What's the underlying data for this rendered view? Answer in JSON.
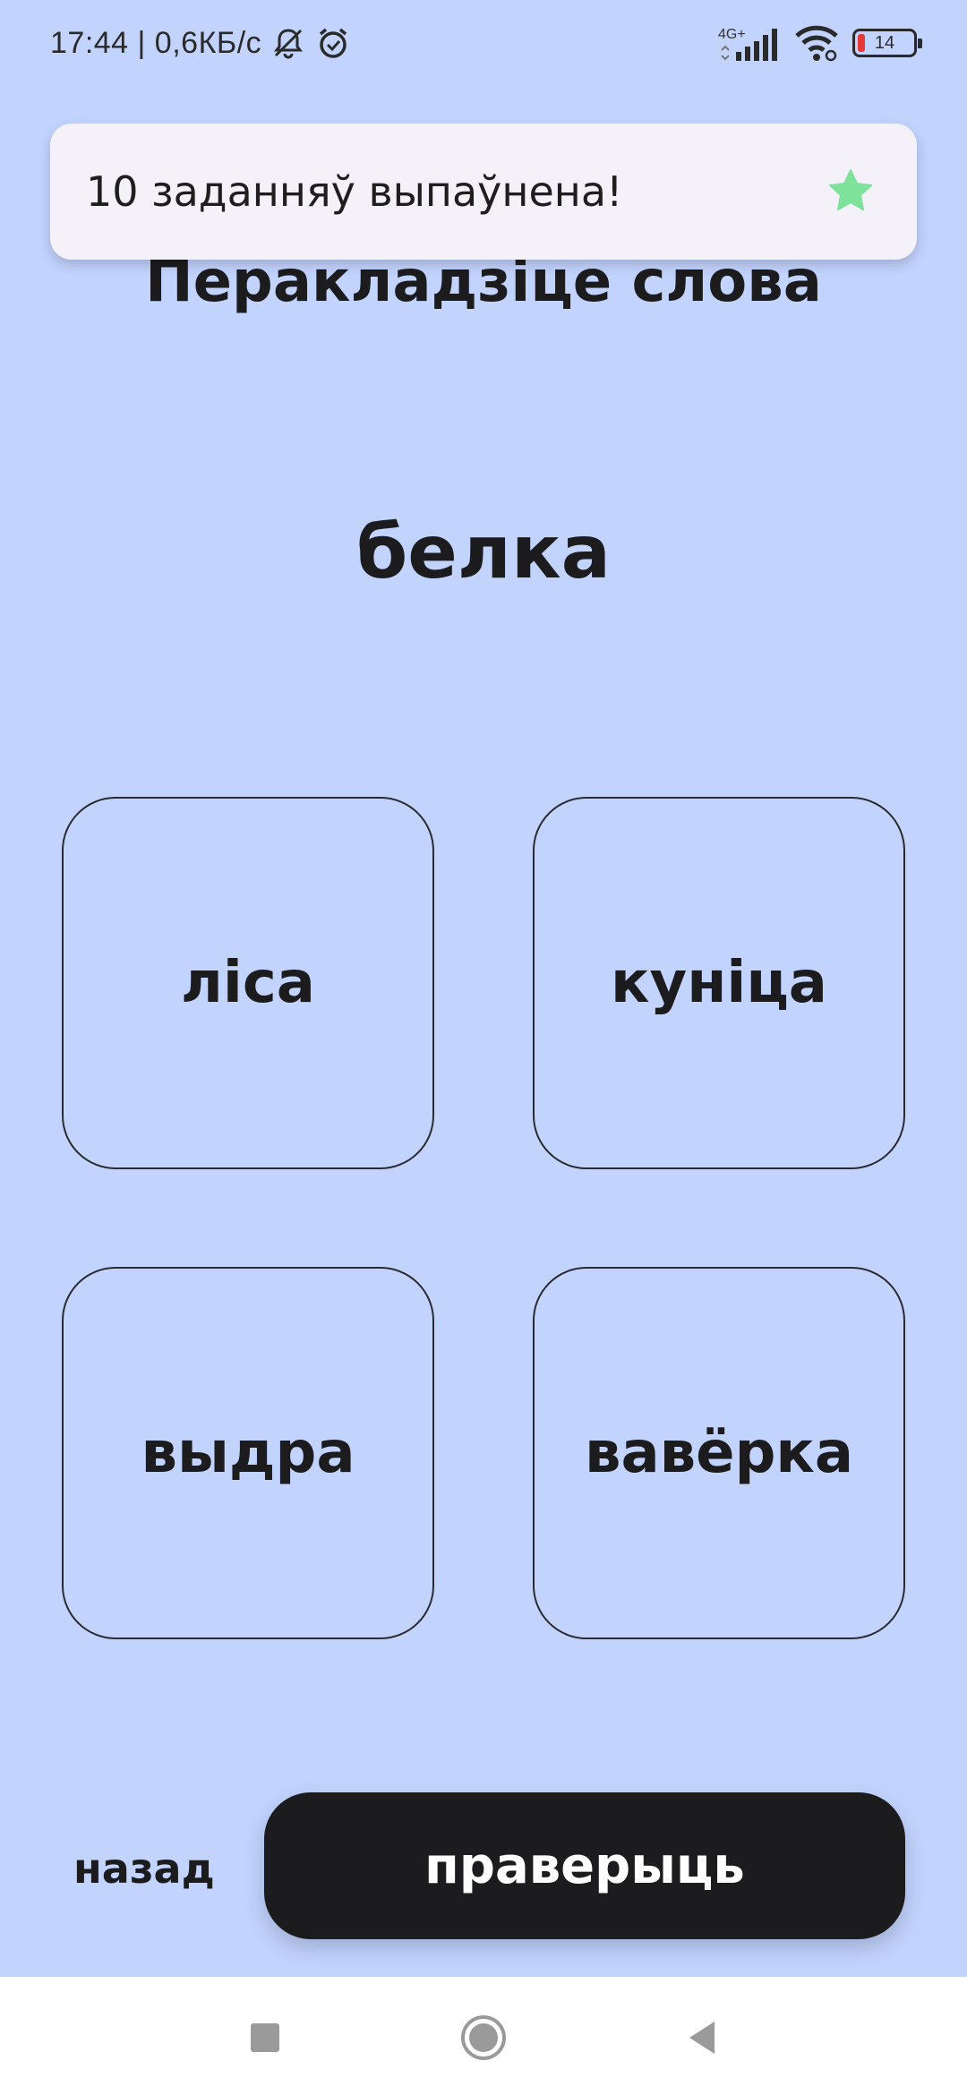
{
  "status_bar": {
    "time_speed": "17:44 | 0,6КБ/с",
    "network_type": "4G+",
    "battery_level": "14",
    "icons": [
      "bell-muted-icon",
      "alarm-icon",
      "signal-icon",
      "wifi-icon",
      "battery-icon"
    ]
  },
  "toast": {
    "message": "10 заданняў выпаўнена!",
    "icon": "star-icon",
    "icon_color": "#7ee29a"
  },
  "exercise": {
    "title": "Перакладзіце слова",
    "word": "белка",
    "options": [
      "ліса",
      "куніца",
      "выдра",
      "вавёрка"
    ]
  },
  "actions": {
    "back_label": "назад",
    "check_label": "праверыць"
  },
  "nav_bar": {
    "buttons": [
      "recents-icon",
      "home-icon",
      "back-icon"
    ]
  },
  "colors": {
    "background": "#c2d3fe",
    "button": "#1c1c1e",
    "toast_bg": "#f4f1f8"
  }
}
